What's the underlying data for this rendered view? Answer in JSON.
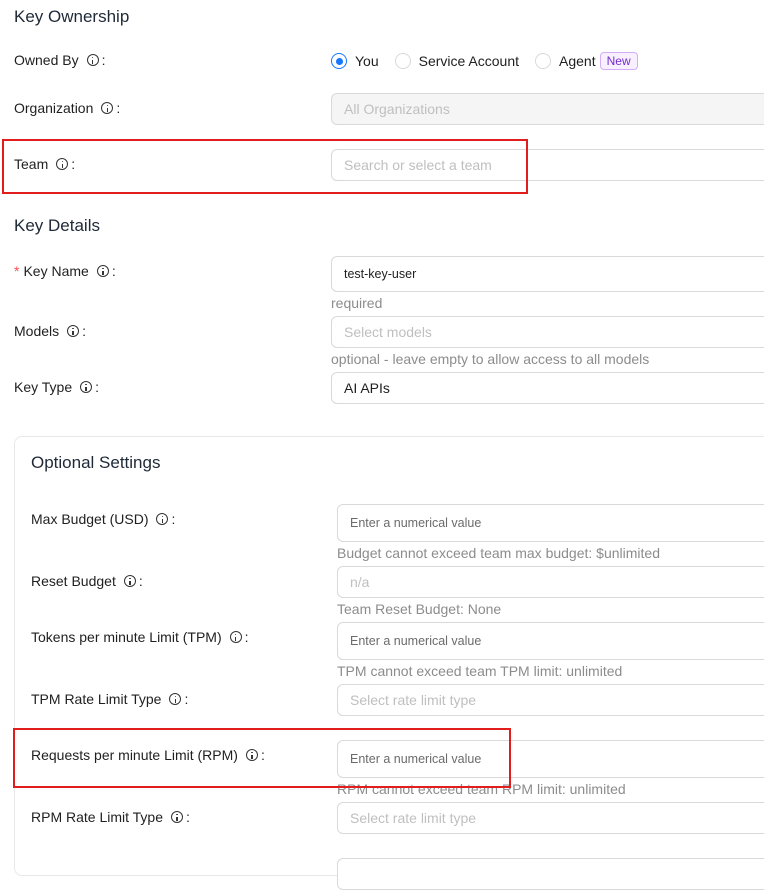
{
  "key_ownership": {
    "title": "Key Ownership",
    "owned_by": {
      "label": "Owned By",
      "options": [
        "You",
        "Service Account",
        "Agent"
      ],
      "selected": "You",
      "agent_badge": "New"
    },
    "organization": {
      "label": "Organization",
      "placeholder": "All Organizations"
    },
    "team": {
      "label": "Team",
      "placeholder": "Search or select a team"
    }
  },
  "key_details": {
    "title": "Key Details",
    "key_name": {
      "label": "Key Name",
      "value": "test-key-user",
      "help": "required"
    },
    "models": {
      "label": "Models",
      "placeholder": "Select models",
      "help": "optional - leave empty to allow access to all models"
    },
    "key_type": {
      "label": "Key Type",
      "value": "AI APIs"
    }
  },
  "optional_settings": {
    "title": "Optional Settings",
    "max_budget": {
      "label": "Max Budget (USD)",
      "placeholder": "Enter a numerical value",
      "help": "Budget cannot exceed team max budget: $unlimited"
    },
    "reset_budget": {
      "label": "Reset Budget",
      "placeholder": "n/a",
      "help": "Team Reset Budget: None"
    },
    "tpm": {
      "label": "Tokens per minute Limit (TPM)",
      "placeholder": "Enter a numerical value",
      "help": "TPM cannot exceed team TPM limit: unlimited"
    },
    "tpm_type": {
      "label": "TPM Rate Limit Type",
      "placeholder": "Select rate limit type"
    },
    "rpm": {
      "label": "Requests per minute Limit (RPM)",
      "placeholder": "Enter a numerical value",
      "help": "RPM cannot exceed team RPM limit: unlimited"
    },
    "rpm_type": {
      "label": "RPM Rate Limit Type",
      "placeholder": "Select rate limit type"
    }
  }
}
